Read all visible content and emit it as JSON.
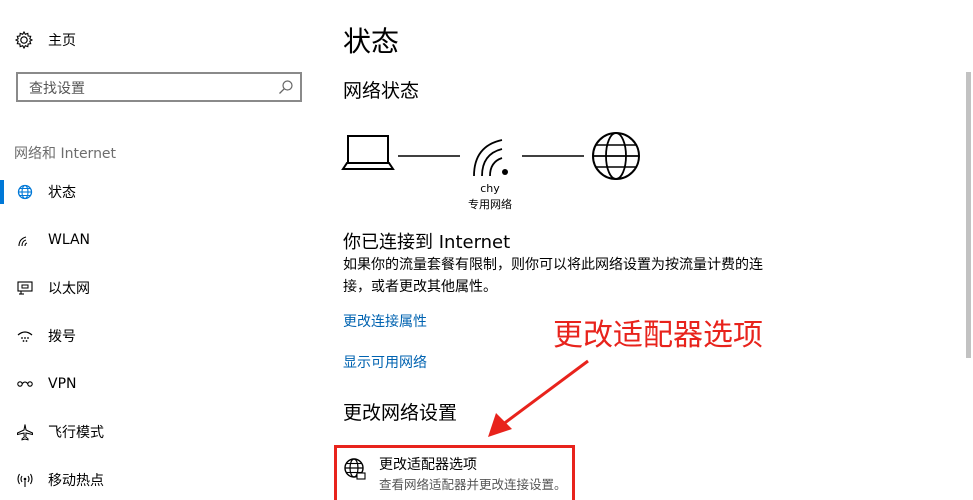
{
  "sidebar": {
    "home_label": "主页",
    "search_placeholder": "查找设置",
    "section_label": "网络和 Internet",
    "items": [
      {
        "label": "状态",
        "icon": "globe-icon",
        "active": true
      },
      {
        "label": "WLAN",
        "icon": "wifi-icon"
      },
      {
        "label": "以太网",
        "icon": "ethernet-icon"
      },
      {
        "label": "拨号",
        "icon": "dialup-icon"
      },
      {
        "label": "VPN",
        "icon": "vpn-icon"
      },
      {
        "label": "飞行模式",
        "icon": "airplane-icon"
      },
      {
        "label": "移动热点",
        "icon": "hotspot-icon"
      }
    ]
  },
  "main": {
    "title": "状态",
    "network_status_heading": "网络状态",
    "network_name": "chy",
    "network_type": "专用网络",
    "connected_title": "你已连接到 Internet",
    "connected_desc": "如果你的流量套餐有限制，则你可以将此网络设置为按流量计费的连接，或者更改其他属性。",
    "link_change_properties": "更改连接属性",
    "link_show_networks": "显示可用网络",
    "change_settings_heading": "更改网络设置",
    "adapter_option_title": "更改适配器选项",
    "adapter_option_desc": "查看网络适配器并更改连接设置。"
  },
  "annotation": {
    "text": "更改适配器选项",
    "color": "#e8231c"
  },
  "colors": {
    "accent": "#0078d7",
    "link": "#0063b1"
  }
}
